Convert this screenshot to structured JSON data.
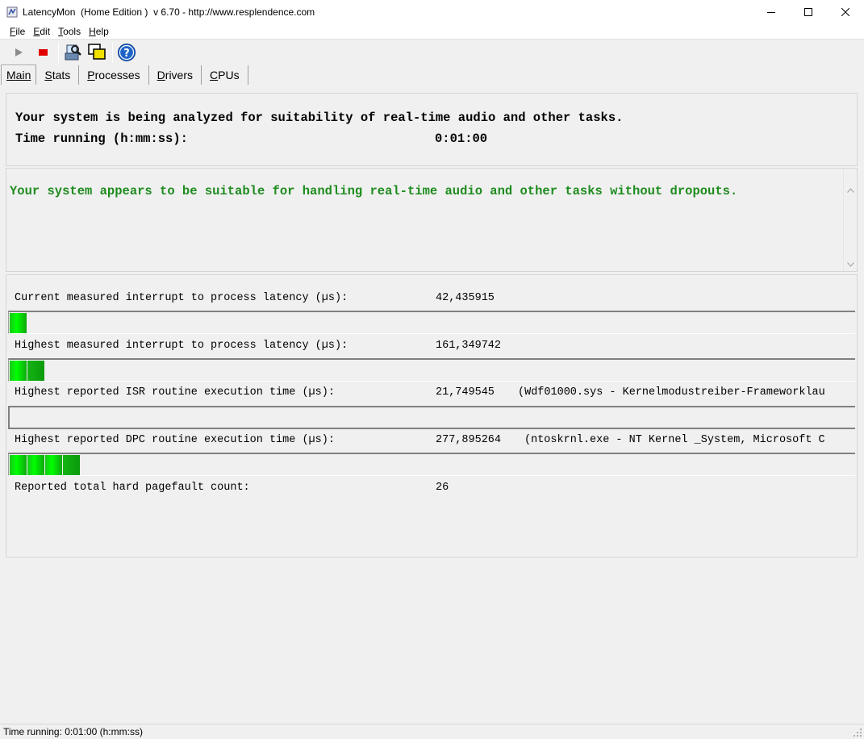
{
  "window": {
    "title": "LatencyMon  (Home Edition )  v 6.70 - http://www.resplendence.com"
  },
  "menu": {
    "items": [
      {
        "key": "F",
        "rest": "ile"
      },
      {
        "key": "E",
        "rest": "dit"
      },
      {
        "key": "T",
        "rest": "ools"
      },
      {
        "key": "H",
        "rest": "elp"
      }
    ]
  },
  "toolbar": {
    "icons": [
      "play-icon",
      "stop-icon",
      "analyze-icon",
      "window-icon",
      "help-icon"
    ],
    "colors": {
      "stop": "#e00000",
      "help": "#1e64c8"
    }
  },
  "tabs": [
    {
      "key": "M",
      "rest": "ain",
      "active": true
    },
    {
      "key": "S",
      "rest": "tats",
      "active": false
    },
    {
      "key": "P",
      "rest": "rocesses",
      "active": false
    },
    {
      "key": "D",
      "rest": "rivers",
      "active": false
    },
    {
      "key": "C",
      "rest": "PUs",
      "active": false
    }
  ],
  "header": {
    "analyzing": "Your system is being analyzed for suitability of real-time audio and other tasks.",
    "time_label": "Time running (h:mm:ss):",
    "time_value": "0:01:00"
  },
  "verdict": {
    "text": "Your system appears to be suitable for handling real-time audio and other tasks without dropouts.",
    "color": "#1e8c1e"
  },
  "metrics": {
    "current_latency": {
      "label": "Current measured interrupt to process latency (µs):",
      "value": "42,435915",
      "extra": "",
      "bar_segments": 1
    },
    "highest_latency": {
      "label": "Highest measured interrupt to process latency (µs):",
      "value": "161,349742",
      "extra": "",
      "bar_segments": 2
    },
    "isr": {
      "label": "Highest reported ISR routine execution time (µs):",
      "value": "21,749545",
      "extra": "(Wdf01000.sys - Kernelmodustreiber-Frameworklau",
      "bar_segments": 0
    },
    "dpc": {
      "label": "Highest reported DPC routine execution time (µs):",
      "value": "277,895264",
      "extra": "(ntoskrnl.exe - NT Kernel _System, Microsoft C",
      "bar_segments": 4
    },
    "pagefault": {
      "label": "Reported total hard pagefault count:",
      "value": "26"
    }
  },
  "status": {
    "text": "Time running: 0:01:00  (h:mm:ss)"
  }
}
